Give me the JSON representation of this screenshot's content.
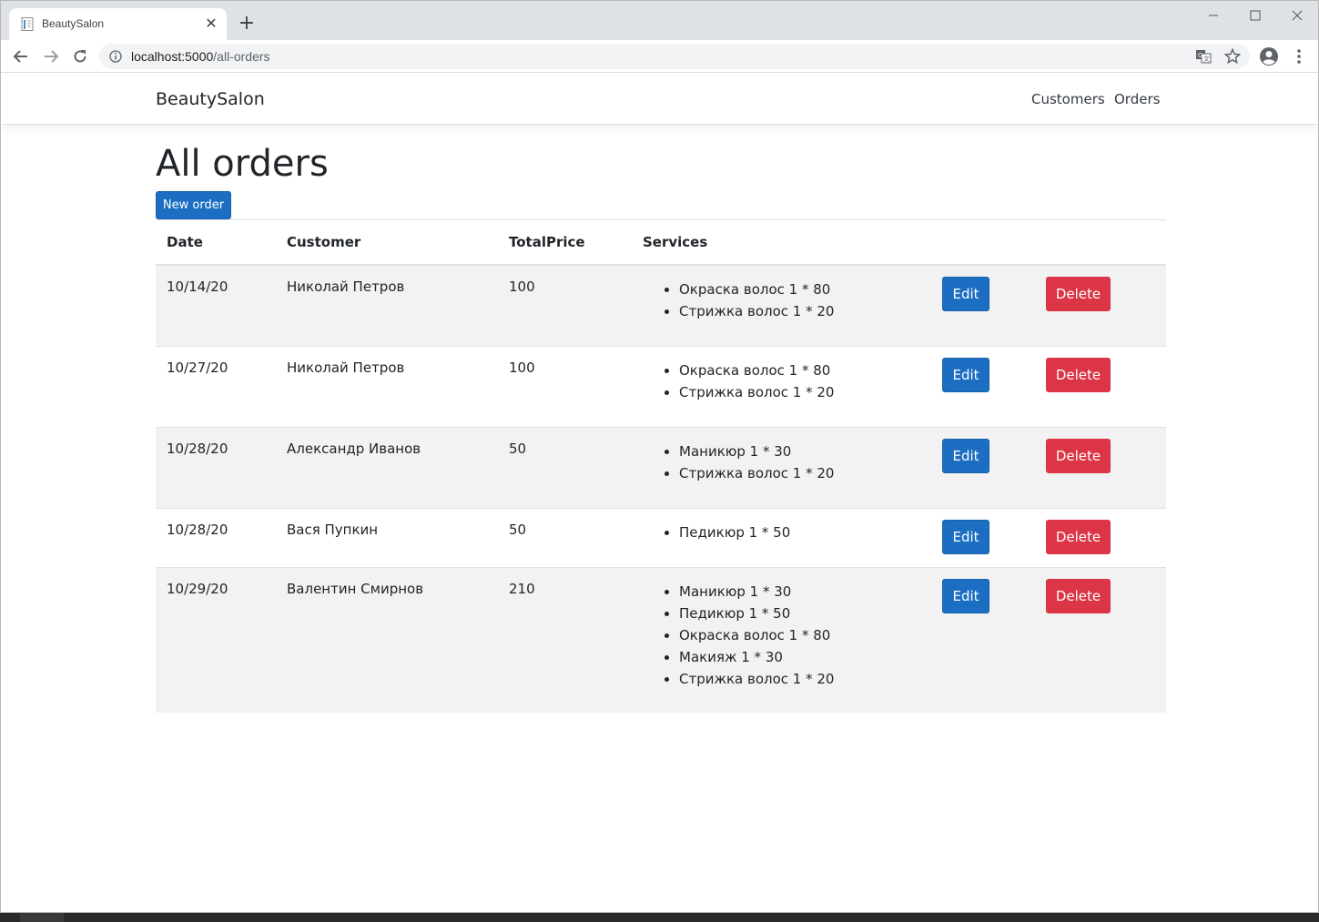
{
  "browser": {
    "tab_title": "BeautySalon",
    "url_host": "localhost:5000",
    "url_path": "/all-orders"
  },
  "navbar": {
    "brand": "BeautySalon",
    "links": [
      "Customers",
      "Orders"
    ]
  },
  "page": {
    "title": "All orders",
    "new_order_label": "New order"
  },
  "table": {
    "headers": [
      "Date",
      "Customer",
      "TotalPrice",
      "Services"
    ],
    "edit_label": "Edit",
    "delete_label": "Delete",
    "rows": [
      {
        "date": "10/14/20",
        "customer": "Николай Петров",
        "total": "100",
        "services": [
          "Окраска волос 1 * 80",
          "Стрижка волос 1 * 20"
        ]
      },
      {
        "date": "10/27/20",
        "customer": "Николай Петров",
        "total": "100",
        "services": [
          "Окраска волос 1 * 80",
          "Стрижка волос 1 * 20"
        ]
      },
      {
        "date": "10/28/20",
        "customer": "Александр Иванов",
        "total": "50",
        "services": [
          "Маникюр 1 * 30",
          "Стрижка волос 1 * 20"
        ]
      },
      {
        "date": "10/28/20",
        "customer": "Вася Пупкин",
        "total": "50",
        "services": [
          "Педикюр 1 * 50"
        ]
      },
      {
        "date": "10/29/20",
        "customer": "Валентин Смирнов",
        "total": "210",
        "services": [
          "Маникюр 1 * 30",
          "Педикюр 1 * 50",
          "Окраска волос 1 * 80",
          "Макияж 1 * 30",
          "Стрижка волос 1 * 20"
        ]
      }
    ]
  }
}
